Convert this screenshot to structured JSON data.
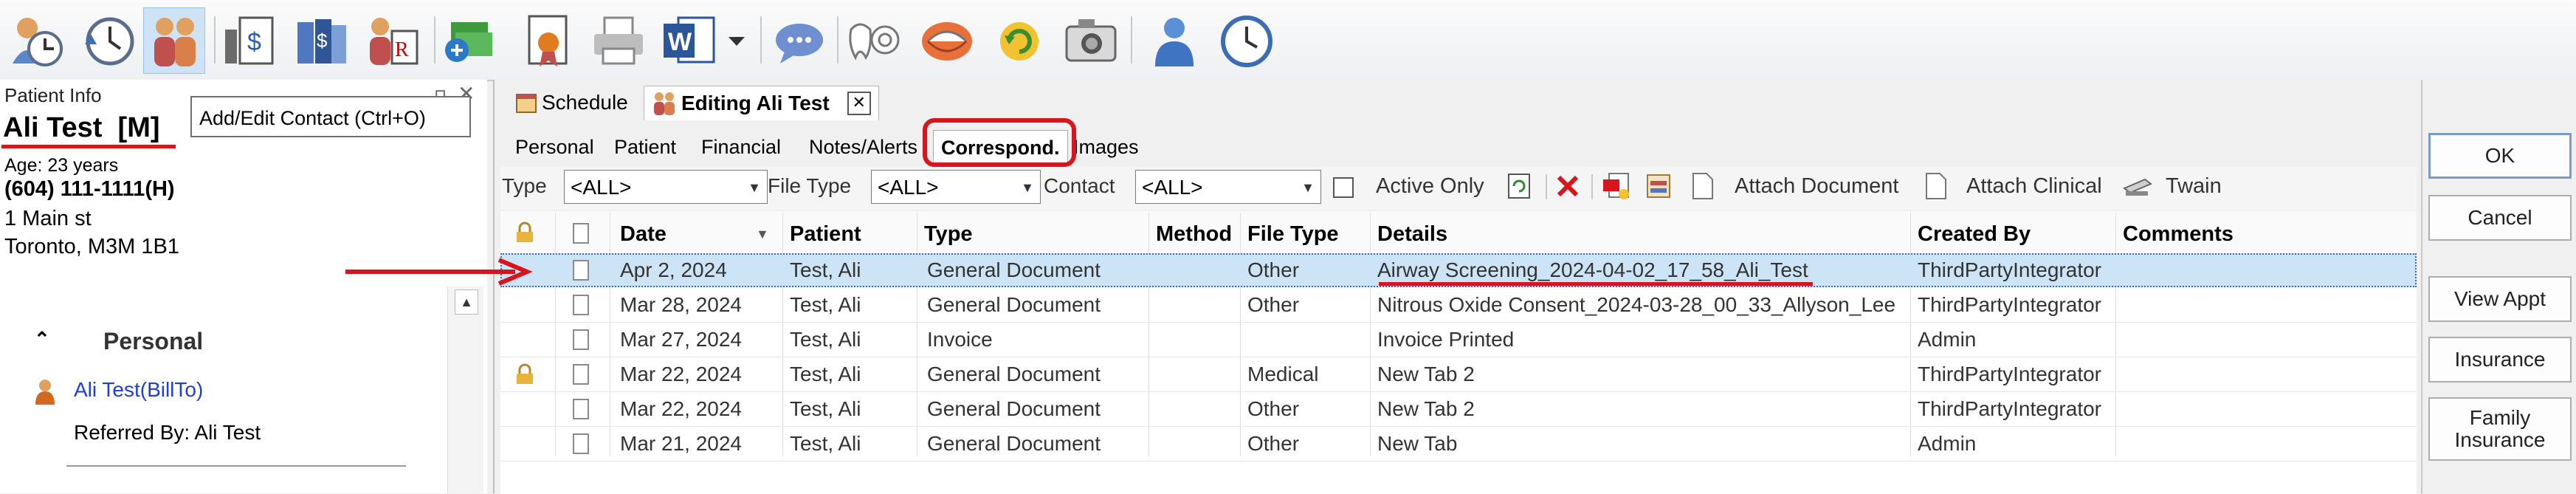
{
  "toolbar": {
    "tooltip": "Add/Edit Contact (Ctrl+O)"
  },
  "patient_panel": {
    "title": "Patient Info",
    "name": "Ali Test  [M]",
    "age": "Age: 23 years",
    "phone": "(604) 111-1111(H)",
    "address_line1": "1 Main st",
    "address_line2": "Toronto, M3M 1B1",
    "section_title": "Personal",
    "bill_to": "Ali Test(BillTo)",
    "referred_by": "Referred By: Ali Test"
  },
  "doc_tabs": {
    "schedule": "Schedule",
    "editing": "Editing Ali Test",
    "close": "✕"
  },
  "subtabs": [
    "Personal",
    "Patient",
    "Financial",
    "Notes/Alerts",
    "Correspond.",
    "Images"
  ],
  "filters": {
    "type_label": "Type",
    "type_value": "<ALL>",
    "file_type_label": "File Type",
    "file_type_value": "<ALL>",
    "contact_label": "Contact",
    "contact_value": "<ALL>",
    "active_only": "Active Only",
    "attach_document": "Attach Document",
    "attach_clinical": "Attach Clinical",
    "twain": "Twain"
  },
  "grid": {
    "columns": [
      "Date",
      "Patient",
      "Type",
      "Method",
      "File Type",
      "Details",
      "Created By",
      "Comments"
    ],
    "rows": [
      {
        "locked": false,
        "date": "Apr 2, 2024",
        "patient": "Test, Ali",
        "type": "General Document",
        "method": "",
        "file_type": "Other",
        "details": "Airway Screening_2024-04-02_17_58_Ali_Test",
        "created_by": "ThirdPartyIntegrator",
        "comments": "",
        "selected": true
      },
      {
        "locked": false,
        "date": "Mar 28, 2024",
        "patient": "Test, Ali",
        "type": "General Document",
        "method": "",
        "file_type": "Other",
        "details": "Nitrous Oxide Consent_2024-03-28_00_33_Allyson_Lee",
        "created_by": "ThirdPartyIntegrator",
        "comments": ""
      },
      {
        "locked": false,
        "date": "Mar 27, 2024",
        "patient": "Test, Ali",
        "type": "Invoice",
        "method": "",
        "file_type": "",
        "details": "Invoice Printed",
        "created_by": "Admin",
        "comments": ""
      },
      {
        "locked": true,
        "date": "Mar 22, 2024",
        "patient": "Test, Ali",
        "type": "General Document",
        "method": "",
        "file_type": "Medical",
        "details": "New Tab 2",
        "created_by": "ThirdPartyIntegrator",
        "comments": ""
      },
      {
        "locked": false,
        "date": "Mar 22, 2024",
        "patient": "Test, Ali",
        "type": "General Document",
        "method": "",
        "file_type": "Other",
        "details": "New Tab 2",
        "created_by": "ThirdPartyIntegrator",
        "comments": ""
      },
      {
        "locked": false,
        "date": "Mar 21, 2024",
        "patient": "Test, Ali",
        "type": "General Document",
        "method": "",
        "file_type": "Other",
        "details": "New Tab",
        "created_by": "Admin",
        "comments": ""
      }
    ]
  },
  "actions": {
    "ok": "OK",
    "cancel": "Cancel",
    "view_appt": "View Appt",
    "insurance": "Insurance",
    "family_insurance": "Family Insurance"
  }
}
